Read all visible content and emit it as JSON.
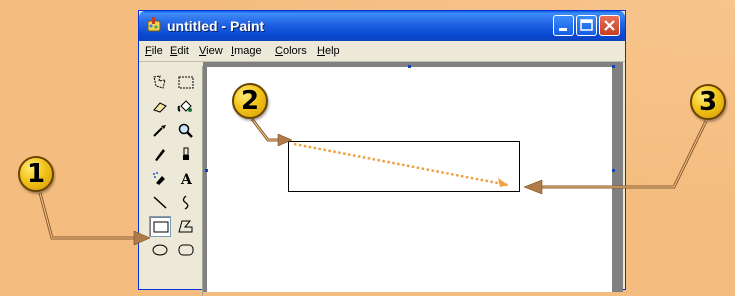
{
  "window": {
    "title": "untitled - Paint",
    "icon": "paint-app-icon",
    "controls": [
      "minimize-icon",
      "maximize-icon",
      "close-icon"
    ]
  },
  "menu": {
    "items": [
      {
        "mnemonic": "F",
        "rest": "ile"
      },
      {
        "mnemonic": "E",
        "rest": "dit"
      },
      {
        "mnemonic": "V",
        "rest": "iew"
      },
      {
        "mnemonic": "I",
        "rest": "mage"
      },
      {
        "mnemonic": "C",
        "rest": "olors"
      },
      {
        "mnemonic": "H",
        "rest": "elp"
      }
    ]
  },
  "toolbox": {
    "tools": [
      "free-form-select",
      "select",
      "eraser",
      "fill-with-color",
      "pick-color",
      "magnifier",
      "pencil",
      "brush",
      "airbrush",
      "text",
      "line",
      "curve",
      "rectangle",
      "polygon",
      "ellipse",
      "rounded-rectangle"
    ],
    "text_tool_glyph": "A",
    "selected_tool": "rectangle"
  },
  "callouts": [
    {
      "number": "1"
    },
    {
      "number": "2"
    },
    {
      "number": "3"
    }
  ],
  "colors": {
    "background": "#f4bc7e",
    "badge": "#f2c419",
    "arrow": "#b07a4a",
    "drag_line": "#f0a040",
    "titlebar": "#0a5fe4"
  }
}
